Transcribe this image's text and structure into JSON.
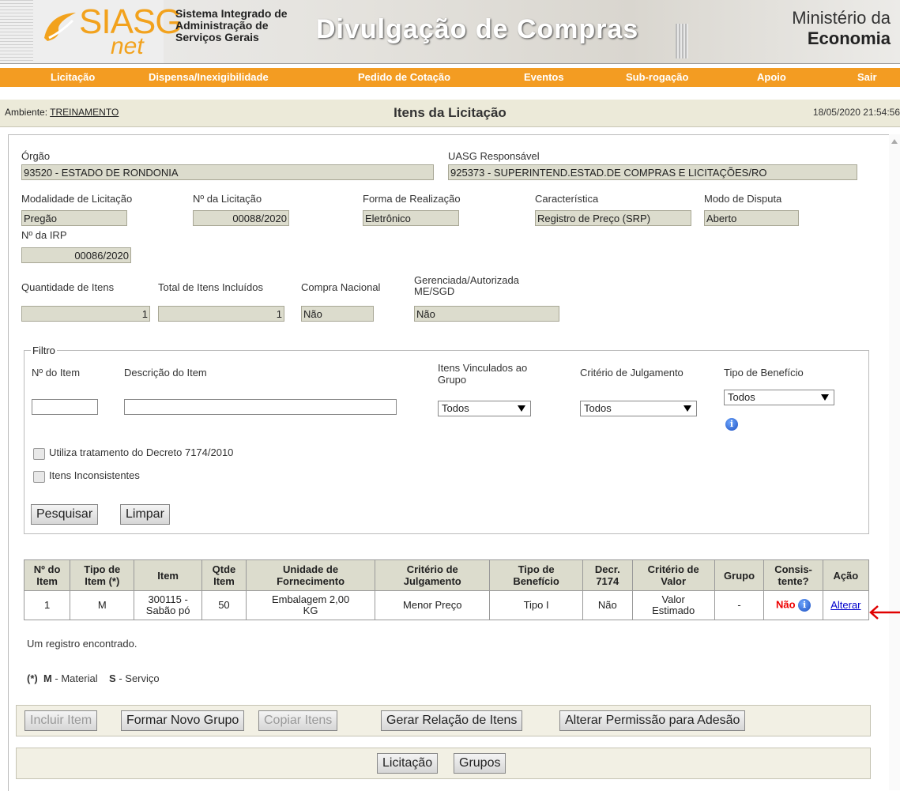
{
  "header": {
    "logo_text": "SIASG",
    "logo_sub": "net",
    "system_name": [
      "Sistema Integrado de",
      "Administração de",
      "Serviços Gerais"
    ],
    "brand": "Divulgação de Compras",
    "ministry_line1": "Ministério da",
    "ministry_line2": "Economia"
  },
  "nav": [
    "Licitação",
    "Dispensa/Inexigibilidade",
    "Pedido de Cotação",
    "Eventos",
    "Sub-rogação",
    "Apoio",
    "Sair"
  ],
  "envbar": {
    "ambiente_label": "Ambiente: ",
    "ambiente_value": "TREINAMENTO",
    "title": "Itens da Licitação",
    "datetime": "18/05/2020 21:54:56"
  },
  "form": {
    "orgao_label": "Órgão",
    "orgao_value": "93520 - ESTADO DE RONDONIA",
    "uasg_label": "UASG Responsável",
    "uasg_value": "925373 - SUPERINTEND.ESTAD.DE COMPRAS E LICITAÇÕES/RO",
    "modalidade_label": "Modalidade de Licitação",
    "modalidade_value": "Pregão",
    "num_licitacao_label": "Nº da Licitação",
    "num_licitacao_value": "00088/2020",
    "forma_label": "Forma de Realização",
    "forma_value": "Eletrônico",
    "caracteristica_label": "Característica",
    "caracteristica_value": "Registro de Preço (SRP)",
    "modo_label": "Modo de Disputa",
    "modo_value": "Aberto",
    "irp_label": "Nº da IRP",
    "irp_value": "00086/2020",
    "qtd_itens_label": "Quantidade de Itens",
    "qtd_itens_value": "1",
    "total_itens_label": "Total de Itens Incluídos",
    "total_itens_value": "1",
    "compra_nacional_label": "Compra Nacional",
    "compra_nacional_value": "Não",
    "gerenciada_label_1": "Gerenciada/Autorizada",
    "gerenciada_label_2": "ME/SGD",
    "gerenciada_value": "Não"
  },
  "filtro": {
    "legend": "Filtro",
    "num_item_label": "Nº do Item",
    "descricao_label": "Descrição do Item",
    "vinculados_label_1": "Itens Vinculados ao",
    "vinculados_label_2": "Grupo",
    "vinculados_value": "Todos",
    "criterio_label": "Critério de Julgamento",
    "criterio_value": "Todos",
    "beneficio_label": "Tipo de Benefício",
    "beneficio_value": "Todos",
    "decreto_label": "Utiliza tratamento do Decreto 7174/2010",
    "inconsistentes_label": "Itens Inconsistentes",
    "pesquisar": "Pesquisar",
    "limpar": "Limpar"
  },
  "table": {
    "headers": [
      [
        "Nº do",
        "Item"
      ],
      [
        "Tipo de",
        "Item (*)"
      ],
      [
        "Item"
      ],
      [
        "Qtde",
        "Item"
      ],
      [
        "Unidade de",
        "Fornecimento"
      ],
      [
        "Critério de",
        "Julgamento"
      ],
      [
        "Tipo de",
        "Benefício"
      ],
      [
        "Decr.",
        "7174"
      ],
      [
        "Critério de",
        "Valor"
      ],
      [
        "Grupo"
      ],
      [
        "Consis-",
        "tente?"
      ],
      [
        "Ação"
      ]
    ],
    "row": {
      "num": "1",
      "tipo": "M",
      "item_1": "300115 -",
      "item_2": "Sabão pó",
      "qtde": "50",
      "unidade_1": "Embalagem 2,00",
      "unidade_2": "KG",
      "criterio": "Menor Preço",
      "beneficio": "Tipo I",
      "decr": "Não",
      "valor_1": "Valor",
      "valor_2": "Estimado",
      "grupo": "-",
      "consistente": "Não",
      "acao": "Alterar"
    }
  },
  "result_text": "Um registro encontrado.",
  "legend": {
    "asterisk": "(*)",
    "m_code": "M",
    "m_text": " - Material",
    "s_code": "S",
    "s_text": " - Serviço"
  },
  "actions": {
    "incluir": "Incluir Item",
    "formar": "Formar Novo Grupo",
    "copiar": "Copiar Itens",
    "gerar": "Gerar Relação de Itens",
    "alterar_permissao": "Alterar Permissão para Adesão",
    "licitacao": "Licitação",
    "grupos": "Grupos"
  },
  "colors": {
    "nav_orange": "#f39c22",
    "field_bg": "#dcdccd",
    "red_flag": "#e00000",
    "info_blue": "#1d4fbf"
  },
  "icons": [
    "info-icon",
    "red-arrow-icon",
    "siasg-logo-icon"
  ]
}
